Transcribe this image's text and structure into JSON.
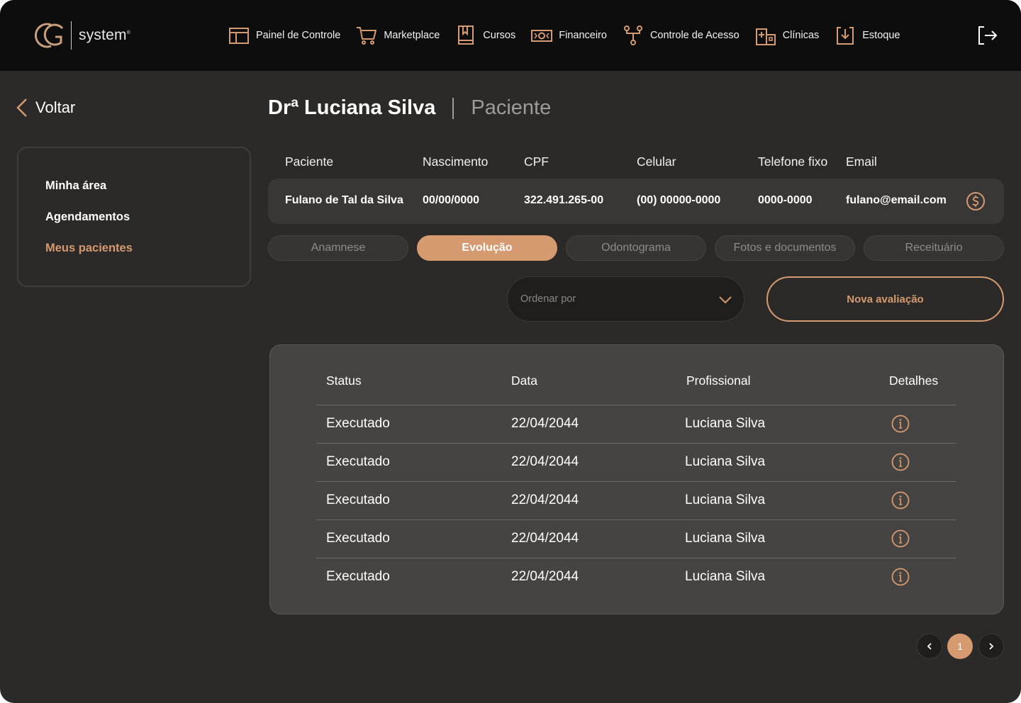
{
  "brand": {
    "mark_text": "CG",
    "wordmark": "system",
    "trademark": "®"
  },
  "nav": [
    {
      "label": "Painel de Controle",
      "icon": "dashboard-icon"
    },
    {
      "label": "Marketplace",
      "icon": "cart-icon"
    },
    {
      "label": "Cursos",
      "icon": "book-icon"
    },
    {
      "label": "Financeiro",
      "icon": "money-icon"
    },
    {
      "label": "Controle de Acesso",
      "icon": "access-tree-icon"
    },
    {
      "label": "Clínicas",
      "icon": "clinic-building-icon"
    },
    {
      "label": "Estoque",
      "icon": "download-box-icon"
    }
  ],
  "back_label": "Voltar",
  "sidebar": {
    "items": [
      {
        "label": "Minha área",
        "active": false
      },
      {
        "label": "Agendamentos",
        "active": false
      },
      {
        "label": "Meus pacientes",
        "active": true
      }
    ]
  },
  "header": {
    "name": "Drª Luciana Silva",
    "role": "Paciente"
  },
  "patient": {
    "headers": [
      "Paciente",
      "Nascimento",
      "CPF",
      "Celular",
      "Telefone fixo",
      "Email"
    ],
    "values": [
      "Fulano de Tal da Silva",
      "00/00/0000",
      "322.491.265-00",
      "(00) 00000-0000",
      "0000-0000",
      "fulano@email.com"
    ]
  },
  "tabs": [
    {
      "label": "Anamnese",
      "active": false
    },
    {
      "label": "Evolução",
      "active": true
    },
    {
      "label": "Odontograma",
      "active": false
    },
    {
      "label": "Fotos e documentos",
      "active": false
    },
    {
      "label": "Receituário",
      "active": false
    }
  ],
  "sort": {
    "placeholder": "Ordenar por"
  },
  "new_button": "Nova avaliação",
  "table": {
    "headers": [
      "Status",
      "Data",
      "Profissional",
      "Detalhes"
    ],
    "rows": [
      {
        "status": "Executado",
        "date": "22/04/2044",
        "professional": "Luciana Silva"
      },
      {
        "status": "Executado",
        "date": "22/04/2044",
        "professional": "Luciana Silva"
      },
      {
        "status": "Executado",
        "date": "22/04/2044",
        "professional": "Luciana Silva"
      },
      {
        "status": "Executado",
        "date": "22/04/2044",
        "professional": "Luciana Silva"
      },
      {
        "status": "Executado",
        "date": "22/04/2044",
        "professional": "Luciana Silva"
      }
    ]
  },
  "pagination": {
    "current_page": "1"
  },
  "colors": {
    "accent": "#d69a70",
    "background": "#2b2a29",
    "topbar": "#0d0d0d",
    "card": "#454442"
  }
}
